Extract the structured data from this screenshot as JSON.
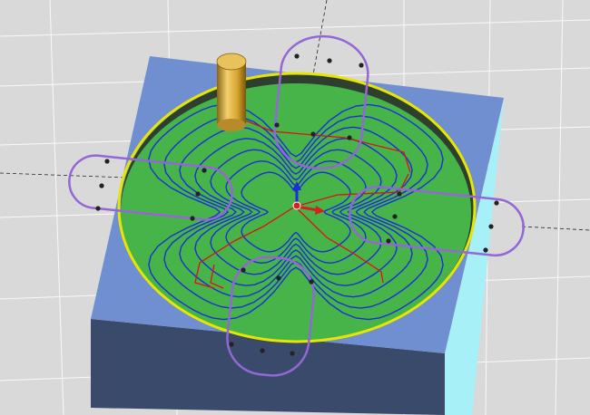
{
  "viewport": {
    "name": "cam-3d-viewport",
    "background_color": "#d9d9d9",
    "grid_color": "#ffffff"
  },
  "colors": {
    "block_top": "#6f8fd0",
    "block_side_left": "#3a4a6a",
    "block_side_right": "#a8f0f7",
    "floor": "#46b449",
    "pocket_rim": "#e6e600",
    "tool_body": "#e0b340",
    "toolpath_cut": "#1b2fd6",
    "toolpath_link": "#e01010",
    "boundary_slot": "#9466d6",
    "triad_z": "#1c2fd4",
    "triad_x": "#d52020"
  },
  "icons": {
    "tool": "end-mill-icon",
    "wcs": "coordinate-triad-icon"
  }
}
